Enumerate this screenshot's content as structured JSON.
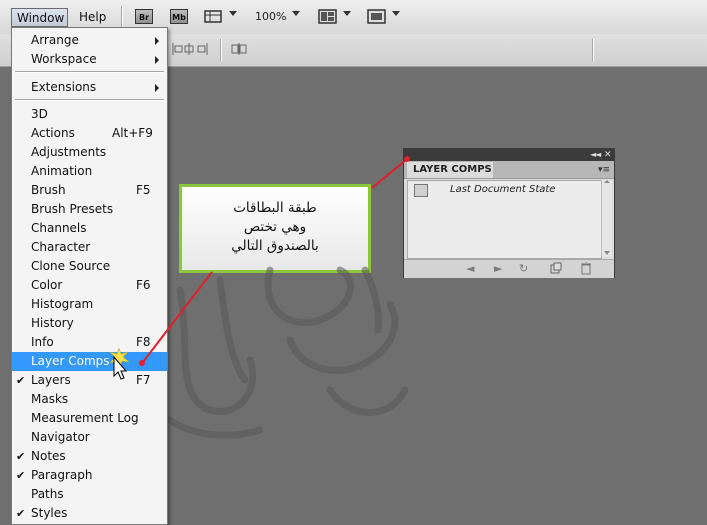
{
  "menubar": {
    "window_label": "Window",
    "help_label": "Help",
    "bridge_label": "Br",
    "minibridge_label": "Mb",
    "zoom_value": "100%"
  },
  "window_menu": {
    "items": [
      {
        "label": "Arrange",
        "submenu": true
      },
      {
        "label": "Workspace",
        "submenu": true
      },
      {
        "label": "Extensions",
        "submenu": true
      },
      {
        "label": "3D"
      },
      {
        "label": "Actions",
        "shortcut": "Alt+F9"
      },
      {
        "label": "Adjustments"
      },
      {
        "label": "Animation"
      },
      {
        "label": "Brush",
        "shortcut": "F5"
      },
      {
        "label": "Brush Presets"
      },
      {
        "label": "Channels"
      },
      {
        "label": "Character"
      },
      {
        "label": "Clone Source"
      },
      {
        "label": "Color",
        "shortcut": "F6"
      },
      {
        "label": "Histogram"
      },
      {
        "label": "History"
      },
      {
        "label": "Info",
        "shortcut": "F8"
      },
      {
        "label": "Layer Comps",
        "highlighted": true
      },
      {
        "label": "Layers",
        "shortcut": "F7",
        "checked": true
      },
      {
        "label": "Masks"
      },
      {
        "label": "Measurement Log"
      },
      {
        "label": "Navigator"
      },
      {
        "label": "Notes",
        "checked": true
      },
      {
        "label": "Paragraph",
        "checked": true
      },
      {
        "label": "Paths"
      },
      {
        "label": "Styles",
        "checked": true
      }
    ],
    "highlight_color": "#3399ff"
  },
  "layer_comps_panel": {
    "tab_label": "LAYER COMPS",
    "row_label": "Last Document State"
  },
  "callout": {
    "lines": [
      "طبقة البطاقات",
      "وهي تختص",
      "بالصندوق التالي"
    ],
    "border_color": "#8cc63f",
    "arrow_color": "#e0202a"
  }
}
